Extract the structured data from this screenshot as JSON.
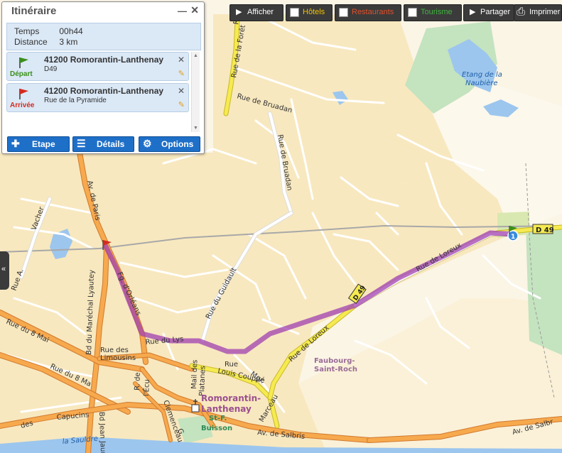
{
  "panel": {
    "title": "Itinéraire",
    "minimize_label": "—",
    "close_label": "✕",
    "summary": {
      "time_label": "Temps",
      "time_value": "00h44",
      "distance_label": "Distance",
      "distance_value": "3 km"
    },
    "stops": [
      {
        "role": "Départ",
        "city": "41200 Romorantin-Lanthenay",
        "street": "D49",
        "flag_color": "#3a8f1a"
      },
      {
        "role": "Arrivée",
        "city": "41200 Romorantin-Lanthenay",
        "street": "Rue de la Pyramide",
        "flag_color": "#d42b1e"
      }
    ],
    "buttons": {
      "etape": "Etape",
      "details": "Détails",
      "options": "Options"
    }
  },
  "toolbar": {
    "afficher": "Afficher",
    "hotels": "Hôtels",
    "restaurants": "Restaurants",
    "tourisme": "Tourisme",
    "partager": "Partager",
    "imprimer": "Imprimer",
    "colors": {
      "hotels": "#f0c200",
      "restaurants": "#e0502a",
      "tourisme": "#3fb53f"
    }
  },
  "sidetab": {
    "label": "«"
  },
  "map": {
    "labels": {
      "rue_foret": "Rue de la Forêt",
      "rue_bruadan1": "Rue de Bruadan",
      "rue_bruadan2": "Rue de Bruadan",
      "etang1": "Etang de la",
      "etang2": "Naubière",
      "av_paris": "Av. de Paris",
      "vacher": "Vacher",
      "rue_a": "Rue A.",
      "rue_guidault": "Rue du Guidault",
      "fg_orleans": "Fg. d'Orléans",
      "rue_loreux1": "Rue de Loreux",
      "rue_loreux2": "Rue de Loreux",
      "rue_lys": "Rue du Lys",
      "d49_road": "D 49",
      "d49_badge": "D 49",
      "bd_lyautey": "Bd du Maréchal Lyautey",
      "rue_8mai": "Rue du 8 Mai",
      "rue_8ma2": "Rue du 8 Ma",
      "limousins1": "Rue des",
      "limousins2": "Limousins",
      "louis_couppe1": "Rue",
      "louis_couppe2": "Louis Couppé",
      "faubourg1": "Faubourg-",
      "faubourg2": "Saint-Roch",
      "mgr1": "Mgr.",
      "mgr2": "Marceau",
      "rue_r": "R. de",
      "lecu": "l'Écu",
      "mail": "Mail des",
      "platanes": "Platanes",
      "romo1": "Romorantin-",
      "romo2": "Lanthenay",
      "capucins": "Capucins",
      "des": "des",
      "st_f": "St-F.",
      "buisson": "Buisson",
      "av_salbris": "Av. de Salbris",
      "av_salb2": "Av. de Salbr",
      "sauldre": "la Sauldre",
      "bd_jaur": "Bd Jean Jaur",
      "clemenceau": "Clemenceau",
      "g": "G.",
      "rue_fo": "Rue"
    },
    "route_color": "#a040b0"
  }
}
